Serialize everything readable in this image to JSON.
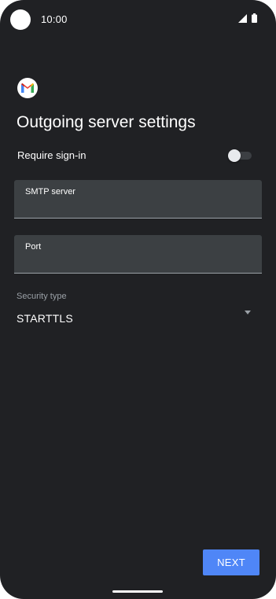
{
  "status_bar": {
    "time": "10:00",
    "icons": [
      "camera-cutout",
      "signal-icon",
      "battery-icon"
    ]
  },
  "app": {
    "logo_icon": "gmail-icon"
  },
  "page": {
    "title": "Outgoing server settings"
  },
  "signin": {
    "label": "Require sign-in",
    "toggle_state": "off"
  },
  "fields": {
    "smtp_server": {
      "label": "SMTP server",
      "value": ""
    },
    "port": {
      "label": "Port",
      "value": ""
    }
  },
  "security": {
    "label": "Security type",
    "selected": "STARTTLS",
    "arrow_icon": "dropdown-arrow-icon"
  },
  "actions": {
    "next_label": "NEXT"
  },
  "colors": {
    "background": "#202124",
    "field_fill": "#3c4043",
    "accent": "#4f86f7",
    "text": "#ffffff",
    "secondary_text": "#9aa0a6"
  }
}
